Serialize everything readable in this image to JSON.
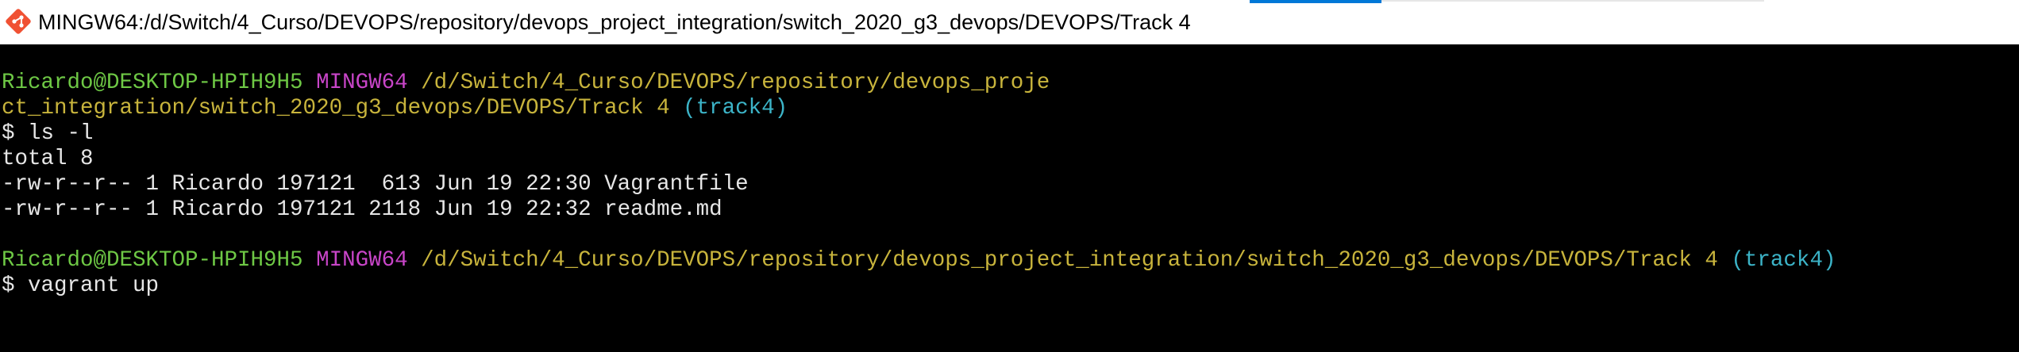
{
  "window": {
    "title": "MINGW64:/d/Switch/4_Curso/DEVOPS/repository/devops_project_integration/switch_2020_g3_devops/DEVOPS/Track 4",
    "icon": "git-bash-icon"
  },
  "colors": {
    "user_host": "#6ec845",
    "env": "#c845c8",
    "path": "#c8b43c",
    "branch": "#3cb4c8",
    "text": "#e6e6e6",
    "background": "#000000",
    "accent": "#0078d7"
  },
  "terminal": {
    "prompt1": {
      "user_host": "Ricardo@DESKTOP-HPIH9H5",
      "env": "MINGW64",
      "path_line1": "/d/Switch/4_Curso/DEVOPS/repository/devops_proje",
      "path_line2": "ct_integration/switch_2020_g3_devops/DEVOPS/Track 4",
      "branch": "(track4)"
    },
    "command1": "$ ls -l",
    "output": [
      "total 8",
      "-rw-r--r-- 1 Ricardo 197121  613 Jun 19 22:30 Vagrantfile",
      "-rw-r--r-- 1 Ricardo 197121 2118 Jun 19 22:32 readme.md"
    ],
    "prompt2": {
      "user_host": "Ricardo@DESKTOP-HPIH9H5",
      "env": "MINGW64",
      "path": "/d/Switch/4_Curso/DEVOPS/repository/devops_project_integration/switch_2020_g3_devops/DEVOPS/Track 4",
      "branch": "(track4)"
    },
    "command2": "$ vagrant up"
  }
}
